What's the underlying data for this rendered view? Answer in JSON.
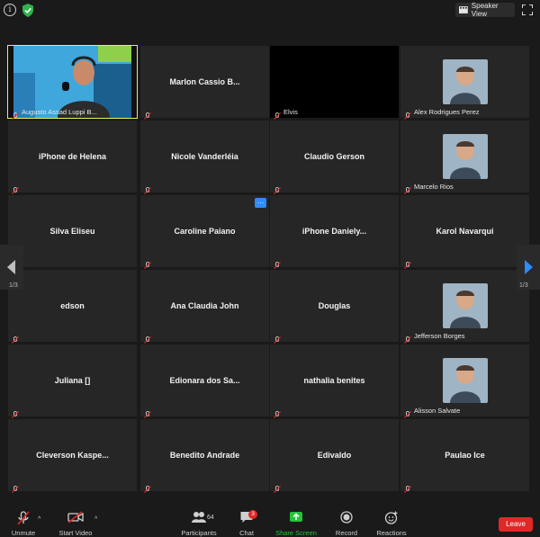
{
  "topbar": {
    "speaker_view_label": "Speaker View"
  },
  "participants": [
    {
      "name": "Augusto Assad Luppi B...",
      "video": true,
      "active": true
    },
    {
      "name": "Marlon Cassio B...",
      "video": false
    },
    {
      "name": "Elvis",
      "video": true,
      "black": true
    },
    {
      "name": "Alex Rodrigues Perez",
      "avatar": true
    },
    {
      "name": "iPhone de Helena",
      "video": false
    },
    {
      "name": "Nicole Vanderléia",
      "video": false
    },
    {
      "name": "Claudio Gerson",
      "video": false
    },
    {
      "name": "Marcelo Rios",
      "avatar": true
    },
    {
      "name": "Silva Eliseu",
      "video": false
    },
    {
      "name": "Caroline Paiano",
      "video": false,
      "more": true
    },
    {
      "name": "iPhone  Daniely...",
      "video": false
    },
    {
      "name": "Karol Navarqui",
      "video": false
    },
    {
      "name": "edson",
      "video": false
    },
    {
      "name": "Ana Claudia John",
      "video": false
    },
    {
      "name": "Douglas",
      "video": false
    },
    {
      "name": "Jefferson Borges",
      "avatar": true
    },
    {
      "name": "Juliana []",
      "video": false
    },
    {
      "name": "Edionara  dos  Sa...",
      "video": false
    },
    {
      "name": "nathalia benites",
      "video": false
    },
    {
      "name": "Alisson Salvate",
      "avatar": true
    },
    {
      "name": "Cleverson  Kaspe...",
      "video": false
    },
    {
      "name": "Benedito Andrade",
      "video": false
    },
    {
      "name": "Edivaldo",
      "video": false
    },
    {
      "name": "Paulao Ice",
      "video": false
    }
  ],
  "pager": {
    "left": "1/3",
    "right": "1/3"
  },
  "toolbar": {
    "unmute": "Unmute",
    "start_video": "Start Video",
    "participants": "Participants",
    "participants_count": "64",
    "chat": "Chat",
    "chat_badge": "3",
    "share_screen": "Share Screen",
    "record": "Record",
    "reactions": "Reactions",
    "leave": "Leave"
  },
  "colors": {
    "accent": "#2d8cff",
    "leave": "#e02828",
    "active_border": "#e8f05a",
    "share_green": "#23c43a"
  }
}
